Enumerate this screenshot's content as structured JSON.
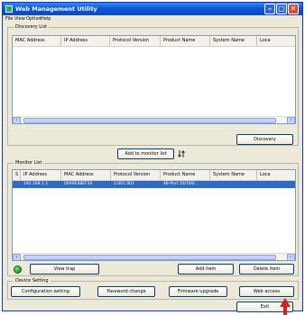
{
  "window": {
    "title": "Web Management Utility",
    "controls": {
      "minimize": "–",
      "maximize": "□",
      "close": "✕"
    }
  },
  "menu": [
    "File",
    "View",
    "Option",
    "Help"
  ],
  "discovery": {
    "group_label": "Discovery List",
    "columns": [
      "MAC Address",
      "IP Address",
      "Protocol Version",
      "Product Name",
      "System Name",
      "Loca"
    ],
    "discovery_button": "Discovery"
  },
  "add_to_monitor_label": "Add to monitor list",
  "monitor": {
    "group_label": "Monitor List",
    "columns": [
      "S",
      "IP Address",
      "MAC Address",
      "Protocol Version",
      "Product Name",
      "System Name",
      "Loca"
    ],
    "rows": [
      {
        "s": "",
        "ip": "192.168.1.1",
        "mac": "00A9E48EF34",
        "protocol": "2.001.001",
        "product": "48-Port 10/100/...",
        "system": "",
        "location": ""
      }
    ],
    "view_trap_button": "View trap",
    "add_item_button": "Add item",
    "delete_item_button": "Delete item"
  },
  "device_setting": {
    "group_label": "Device Setting",
    "configuration_button": "Configuration setting",
    "password_button": "Password change",
    "firmware_button": "Firmware upgrade",
    "web_access_button": "Web access"
  },
  "exit_button": "Exit",
  "colors": {
    "annotation_arrow": "#d42020",
    "selection": "#316ac5",
    "titlebar": "#0a58d6"
  }
}
